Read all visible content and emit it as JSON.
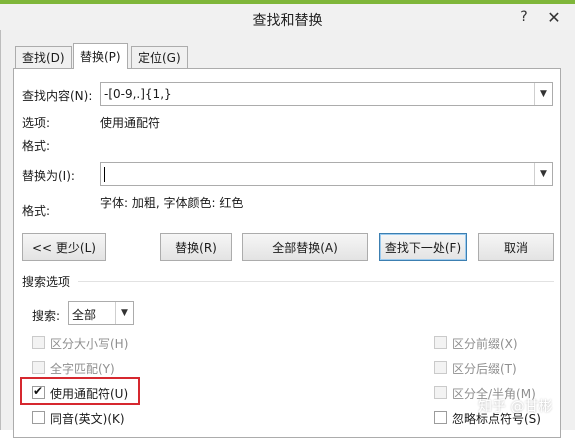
{
  "window": {
    "title": "查找和替换",
    "help": "?",
    "close": "✕"
  },
  "tabs": [
    {
      "label": "查找(D)"
    },
    {
      "label": "替换(P)"
    },
    {
      "label": "定位(G)"
    }
  ],
  "find": {
    "label": "查找内容(N):",
    "value": "-[0-9,.]{1,}",
    "options_label": "选项:",
    "options_value": "使用通配符",
    "format_label": "格式:"
  },
  "replace": {
    "label": "替换为(I):",
    "value": "",
    "format_label": "格式:",
    "format_value": "字体: 加粗, 字体颜色: 红色"
  },
  "buttons": {
    "less": "<< 更少(L)",
    "replace": "替换(R)",
    "replace_all": "全部替换(A)",
    "find_next": "查找下一处(F)",
    "cancel": "取消"
  },
  "search_options": {
    "title": "搜索选项",
    "search_label": "搜索:",
    "search_value": "全部",
    "left": [
      {
        "label": "区分大小写(H)"
      },
      {
        "label": "全字匹配(Y)"
      },
      {
        "label": "使用通配符(U)"
      },
      {
        "label": "同音(英文)(K)"
      }
    ],
    "right": [
      {
        "label": "区分前缀(X)"
      },
      {
        "label": "区分后缀(T)"
      },
      {
        "label": "区分全/半角(M)"
      },
      {
        "label": "忽略标点符号(S)"
      }
    ]
  },
  "watermark": "知乎 @甘彬",
  "colors": {
    "highlight_box": "#d6282f",
    "accent_top": "#7fb63a"
  }
}
